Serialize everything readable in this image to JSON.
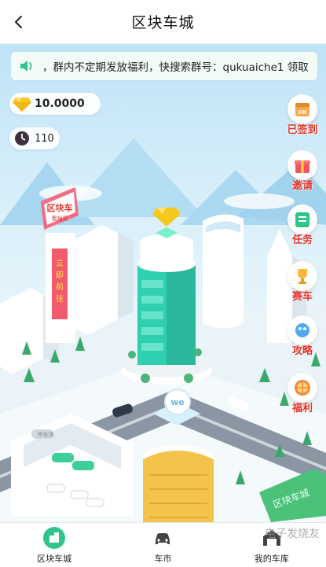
{
  "header": {
    "title": "区块车城",
    "back_icon": "chevron-left-icon"
  },
  "notice": {
    "icon": "speaker-icon",
    "text": "，群内不定期发放福利，快搜索群号：qukuaiche1 领取"
  },
  "wallet": {
    "balance": "10.0000",
    "balance_icon": "diamond-icon",
    "energy": "110",
    "energy_icon": "clock-icon"
  },
  "side_buttons": [
    {
      "label": "已签到",
      "icon": "checkin-icon",
      "color": "#f7a64a"
    },
    {
      "label": "邀请",
      "icon": "gift-icon",
      "color": "#f2555a"
    },
    {
      "label": "任务",
      "icon": "task-icon",
      "color": "#2fc48a"
    },
    {
      "label": "赛车",
      "icon": "trophy-icon",
      "color": "#f5b93c"
    },
    {
      "label": "攻略",
      "icon": "strategy-icon",
      "color": "#52a7f2"
    },
    {
      "label": "福利",
      "icon": "wheel-icon",
      "color": "#f08a3a"
    }
  ],
  "scene": {
    "billboard_top": "区块车",
    "billboard_sub": "看抽奖",
    "banner_vertical": "立即前往",
    "parking_sign": "停车场",
    "logo_badge": "we",
    "hedge_text": "区块车城"
  },
  "nav": {
    "items": [
      {
        "label": "区块车城",
        "icon": "city-icon",
        "active": true
      },
      {
        "label": "车市",
        "icon": "car-icon",
        "active": false
      },
      {
        "label": "我的车库",
        "icon": "garage-icon",
        "active": false
      }
    ]
  },
  "watermark": "电子发烧友",
  "colors": {
    "accent": "#2fc48a",
    "label_red": "#e0352b",
    "diamond": "#f6c81c"
  }
}
